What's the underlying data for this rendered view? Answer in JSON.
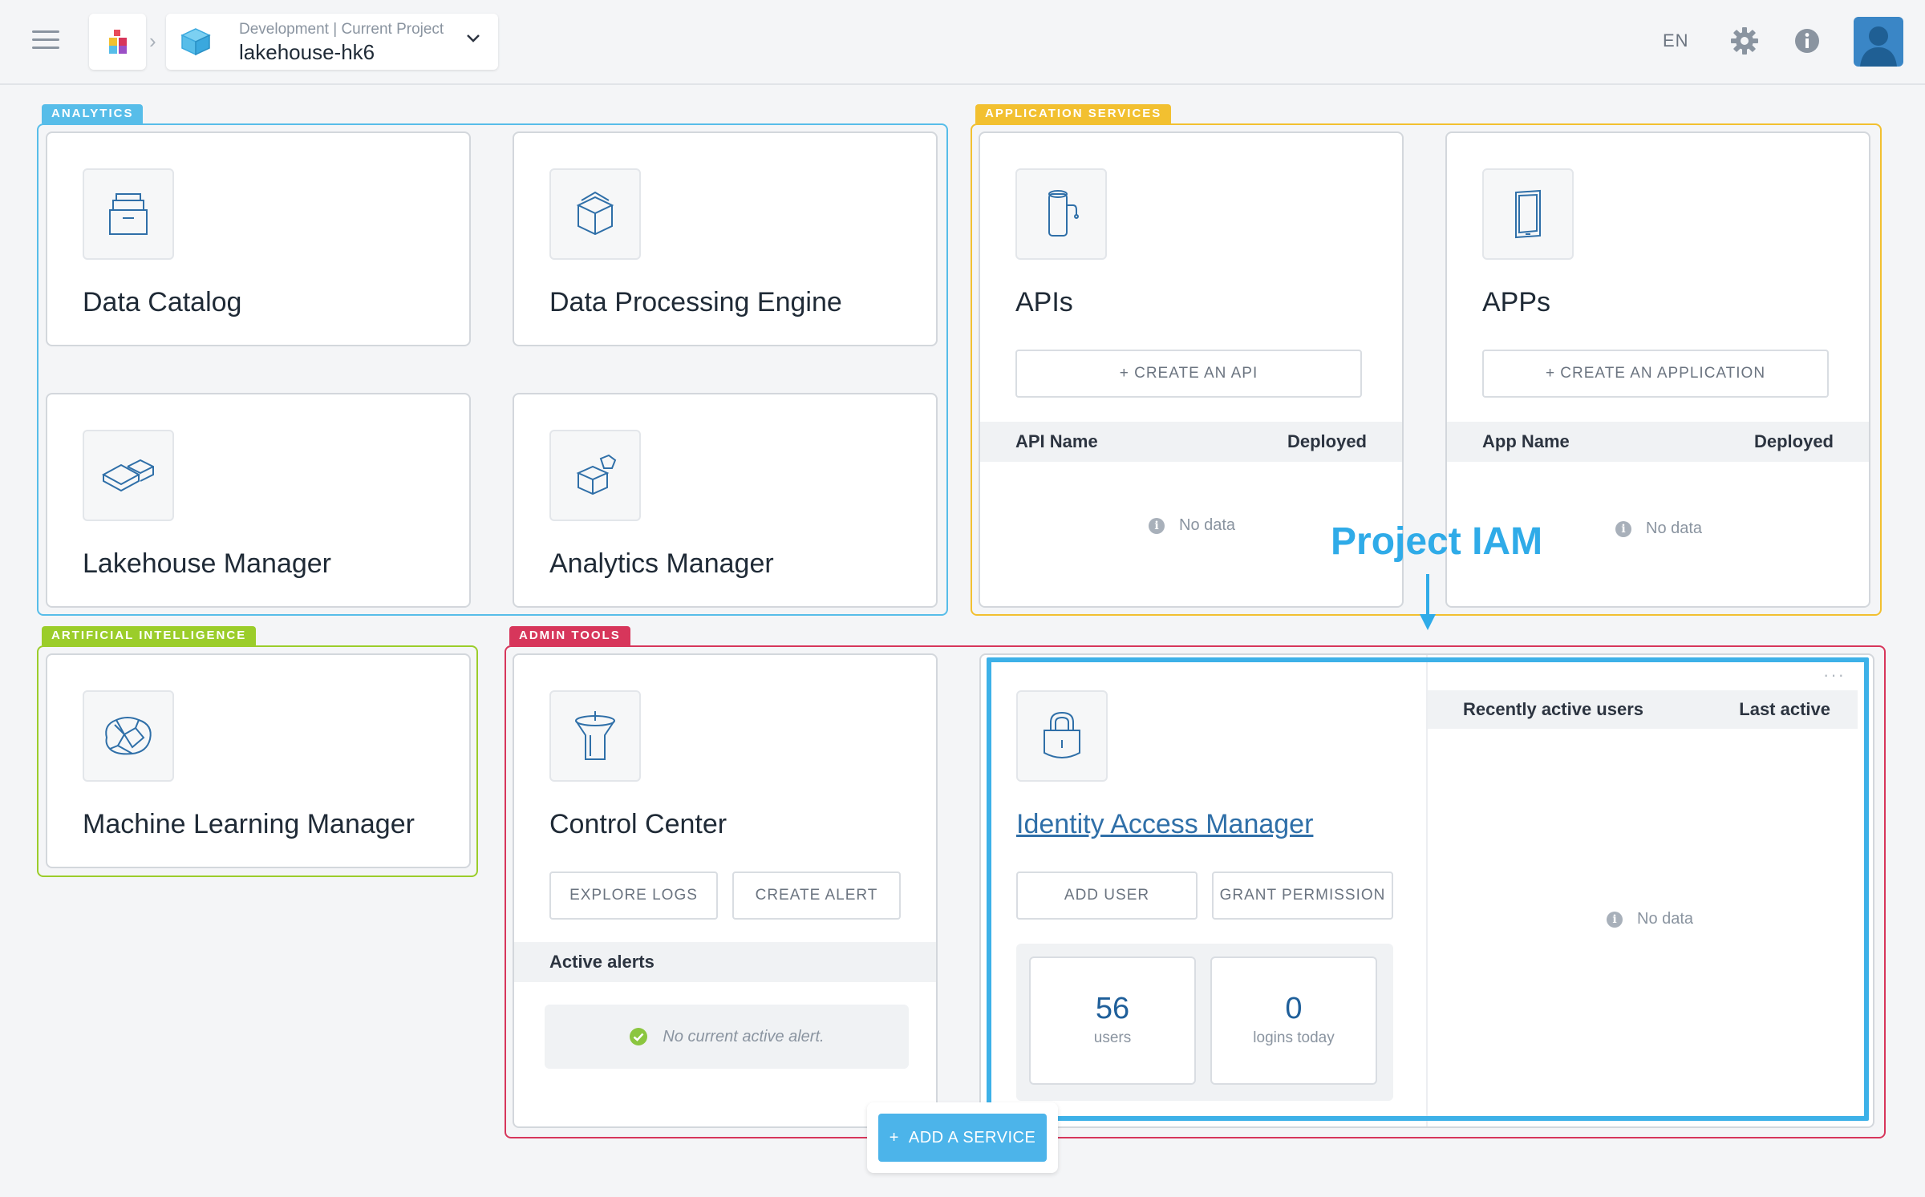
{
  "header": {
    "project_sub": "Development | Current Project",
    "project_name": "lakehouse-hk6",
    "language": "EN"
  },
  "groups": {
    "analytics": "ANALYTICS",
    "application_services": "APPLICATION SERVICES",
    "artificial_intelligence": "ARTIFICIAL INTELLIGENCE",
    "admin_tools": "ADMIN TOOLS"
  },
  "cards": {
    "data_catalog": "Data Catalog",
    "data_processing": "Data Processing Engine",
    "lakehouse_manager": "Lakehouse Manager",
    "analytics_manager": "Analytics Manager",
    "apis": {
      "title": "APIs",
      "create_label": "+ CREATE AN API",
      "col_name": "API Name",
      "col_deployed": "Deployed",
      "empty": "No data"
    },
    "apps": {
      "title": "APPs",
      "create_label": "+ CREATE AN APPLICATION",
      "col_name": "App Name",
      "col_deployed": "Deployed",
      "empty": "No data"
    },
    "ml_manager": "Machine Learning Manager",
    "control_center": {
      "title": "Control Center",
      "explore_logs": "EXPLORE LOGS",
      "create_alert": "CREATE ALERT",
      "alerts_header": "Active alerts",
      "no_alert": "No current active alert."
    },
    "iam": {
      "title": "Identity Access Manager",
      "add_user": "ADD USER",
      "grant_permission": "GRANT PERMISSION",
      "users_count": "56",
      "users_label": "users",
      "logins_count": "0",
      "logins_label": "logins today",
      "recent_header": "Recently active users",
      "last_active_header": "Last active",
      "empty": "No data"
    }
  },
  "annotation": "Project IAM",
  "add_service": "ADD A SERVICE",
  "colors": {
    "analytics": "#57bde9",
    "application_services": "#f2c030",
    "artificial_intelligence": "#9bcd2a",
    "admin_tools": "#d7365b",
    "highlight": "#3db1e8"
  }
}
